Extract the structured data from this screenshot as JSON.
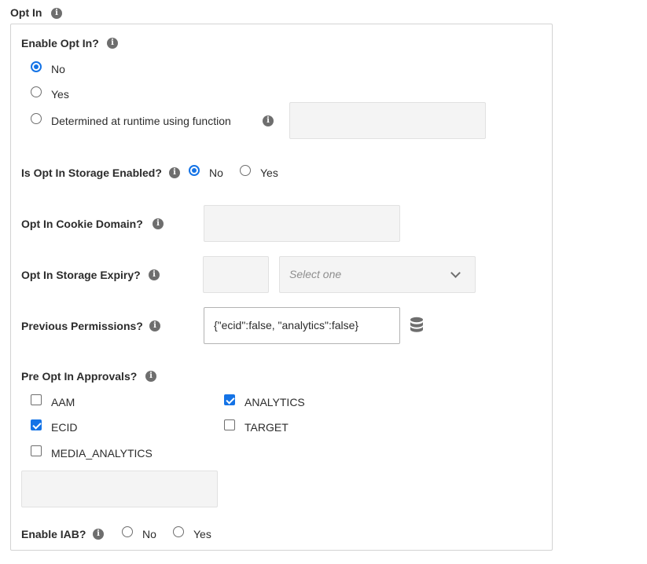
{
  "section": {
    "title": "Opt In"
  },
  "enable_opt_in": {
    "label": "Enable Opt In?",
    "options": [
      "No",
      "Yes",
      "Determined at runtime using function"
    ],
    "selected": "No"
  },
  "storage_enabled": {
    "label": "Is Opt In Storage Enabled?",
    "options": [
      "No",
      "Yes"
    ],
    "selected": "No"
  },
  "cookie_domain": {
    "label": "Opt In Cookie Domain?"
  },
  "storage_expiry": {
    "label": "Opt In Storage Expiry?",
    "select_placeholder": "Select one"
  },
  "previous_permissions": {
    "label": "Previous Permissions?",
    "value": "{\"ecid\":false, \"analytics\":false}"
  },
  "pre_approvals": {
    "label": "Pre Opt In Approvals?",
    "items": [
      {
        "label": "AAM",
        "checked": false
      },
      {
        "label": "ANALYTICS",
        "checked": true
      },
      {
        "label": "ECID",
        "checked": true
      },
      {
        "label": "TARGET",
        "checked": false
      },
      {
        "label": "MEDIA_ANALYTICS",
        "checked": false
      }
    ]
  },
  "enable_iab": {
    "label": "Enable IAB?",
    "options": [
      "No",
      "Yes"
    ],
    "selected": ""
  },
  "icons": {
    "info": "info-icon",
    "data_element": "database-icon",
    "dropdown": "chevron-down-icon"
  },
  "colors": {
    "accent": "#1473e6",
    "field_bg": "#f4f4f4",
    "border": "#d3d3d3"
  }
}
